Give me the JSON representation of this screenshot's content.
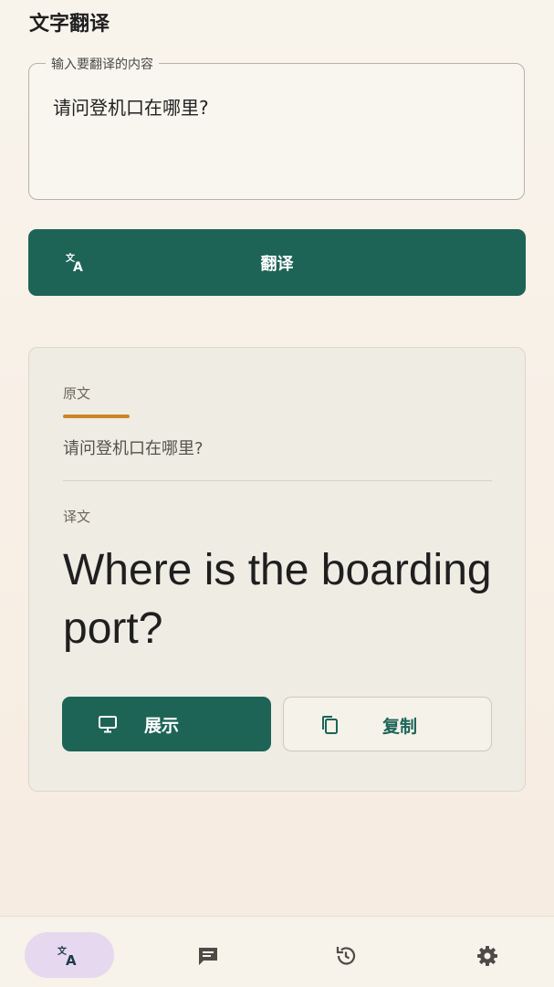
{
  "header": {
    "title": "文字翻译"
  },
  "input": {
    "legend": "输入要翻译的内容",
    "value": "请问登机口在哪里?"
  },
  "translate_button": {
    "label": "翻译",
    "icon": "translate-icon"
  },
  "result": {
    "source_label": "原文",
    "source_text": "请问登机口在哪里?",
    "target_label": "译文",
    "target_text": "Where is the boarding port?"
  },
  "actions": {
    "show_label": "展示",
    "show_icon": "monitor-icon",
    "copy_label": "复制",
    "copy_icon": "copy-icon"
  },
  "bottom_nav": {
    "items": [
      {
        "icon": "translate-icon",
        "active": true
      },
      {
        "icon": "chat-icon",
        "active": false
      },
      {
        "icon": "history-icon",
        "active": false
      },
      {
        "icon": "gear-icon",
        "active": false
      }
    ]
  },
  "colors": {
    "primary": "#1d6457",
    "accent": "#cd8426",
    "nav_active": "#e6d8ee"
  }
}
